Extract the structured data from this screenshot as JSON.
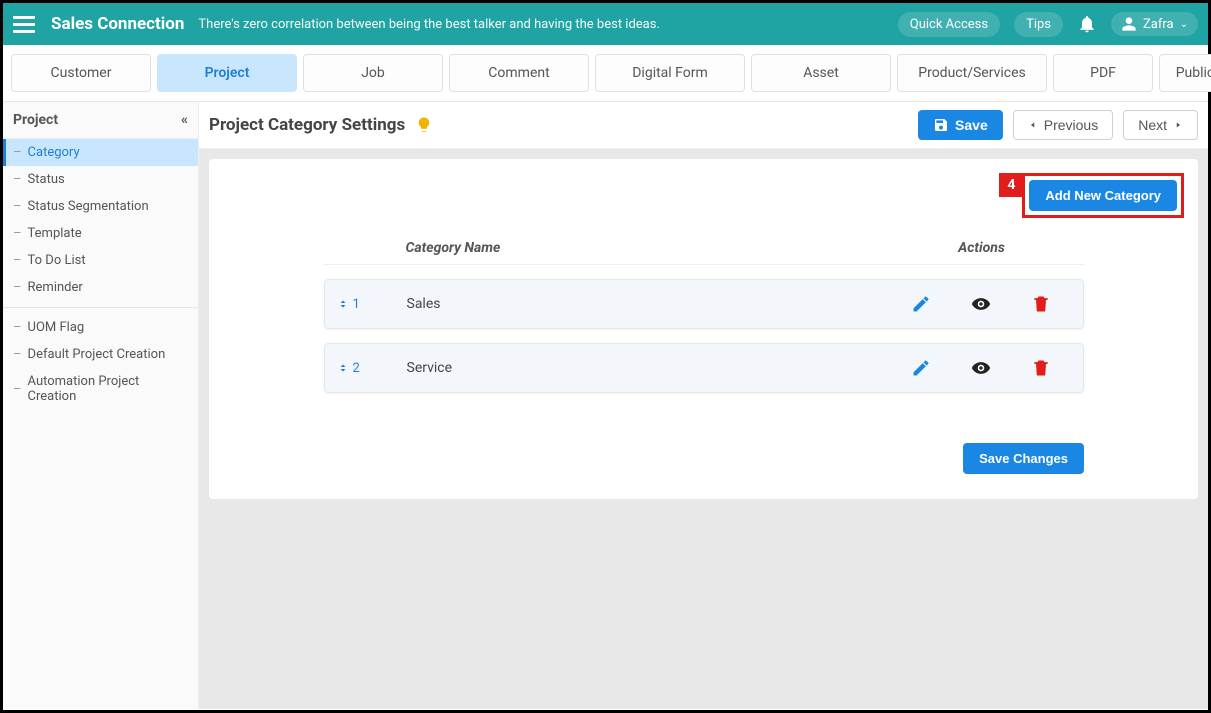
{
  "topbar": {
    "brand": "Sales Connection",
    "tagline": "There's zero correlation between being the best talker and having the best ideas.",
    "quick_access": "Quick Access",
    "tips": "Tips",
    "user_name": "Zafra"
  },
  "tabs": [
    "Customer",
    "Project",
    "Job",
    "Comment",
    "Digital Form",
    "Asset",
    "Product/Services",
    "PDF",
    "Public Fo"
  ],
  "active_tab_index": 1,
  "sidebar": {
    "title": "Project",
    "groups": [
      [
        "Category",
        "Status",
        "Status Segmentation",
        "Template",
        "To Do List",
        "Reminder"
      ],
      [
        "UOM Flag",
        "Default Project Creation",
        "Automation Project Creation"
      ]
    ],
    "active": "Category"
  },
  "page": {
    "title": "Project Category Settings",
    "save": "Save",
    "previous": "Previous",
    "next": "Next"
  },
  "panel": {
    "highlight_num": "4",
    "add_btn": "Add New Category",
    "header_name": "Category Name",
    "header_actions": "Actions",
    "rows": [
      {
        "order": "1",
        "name": "Sales"
      },
      {
        "order": "2",
        "name": "Service"
      }
    ],
    "save_changes": "Save Changes"
  }
}
